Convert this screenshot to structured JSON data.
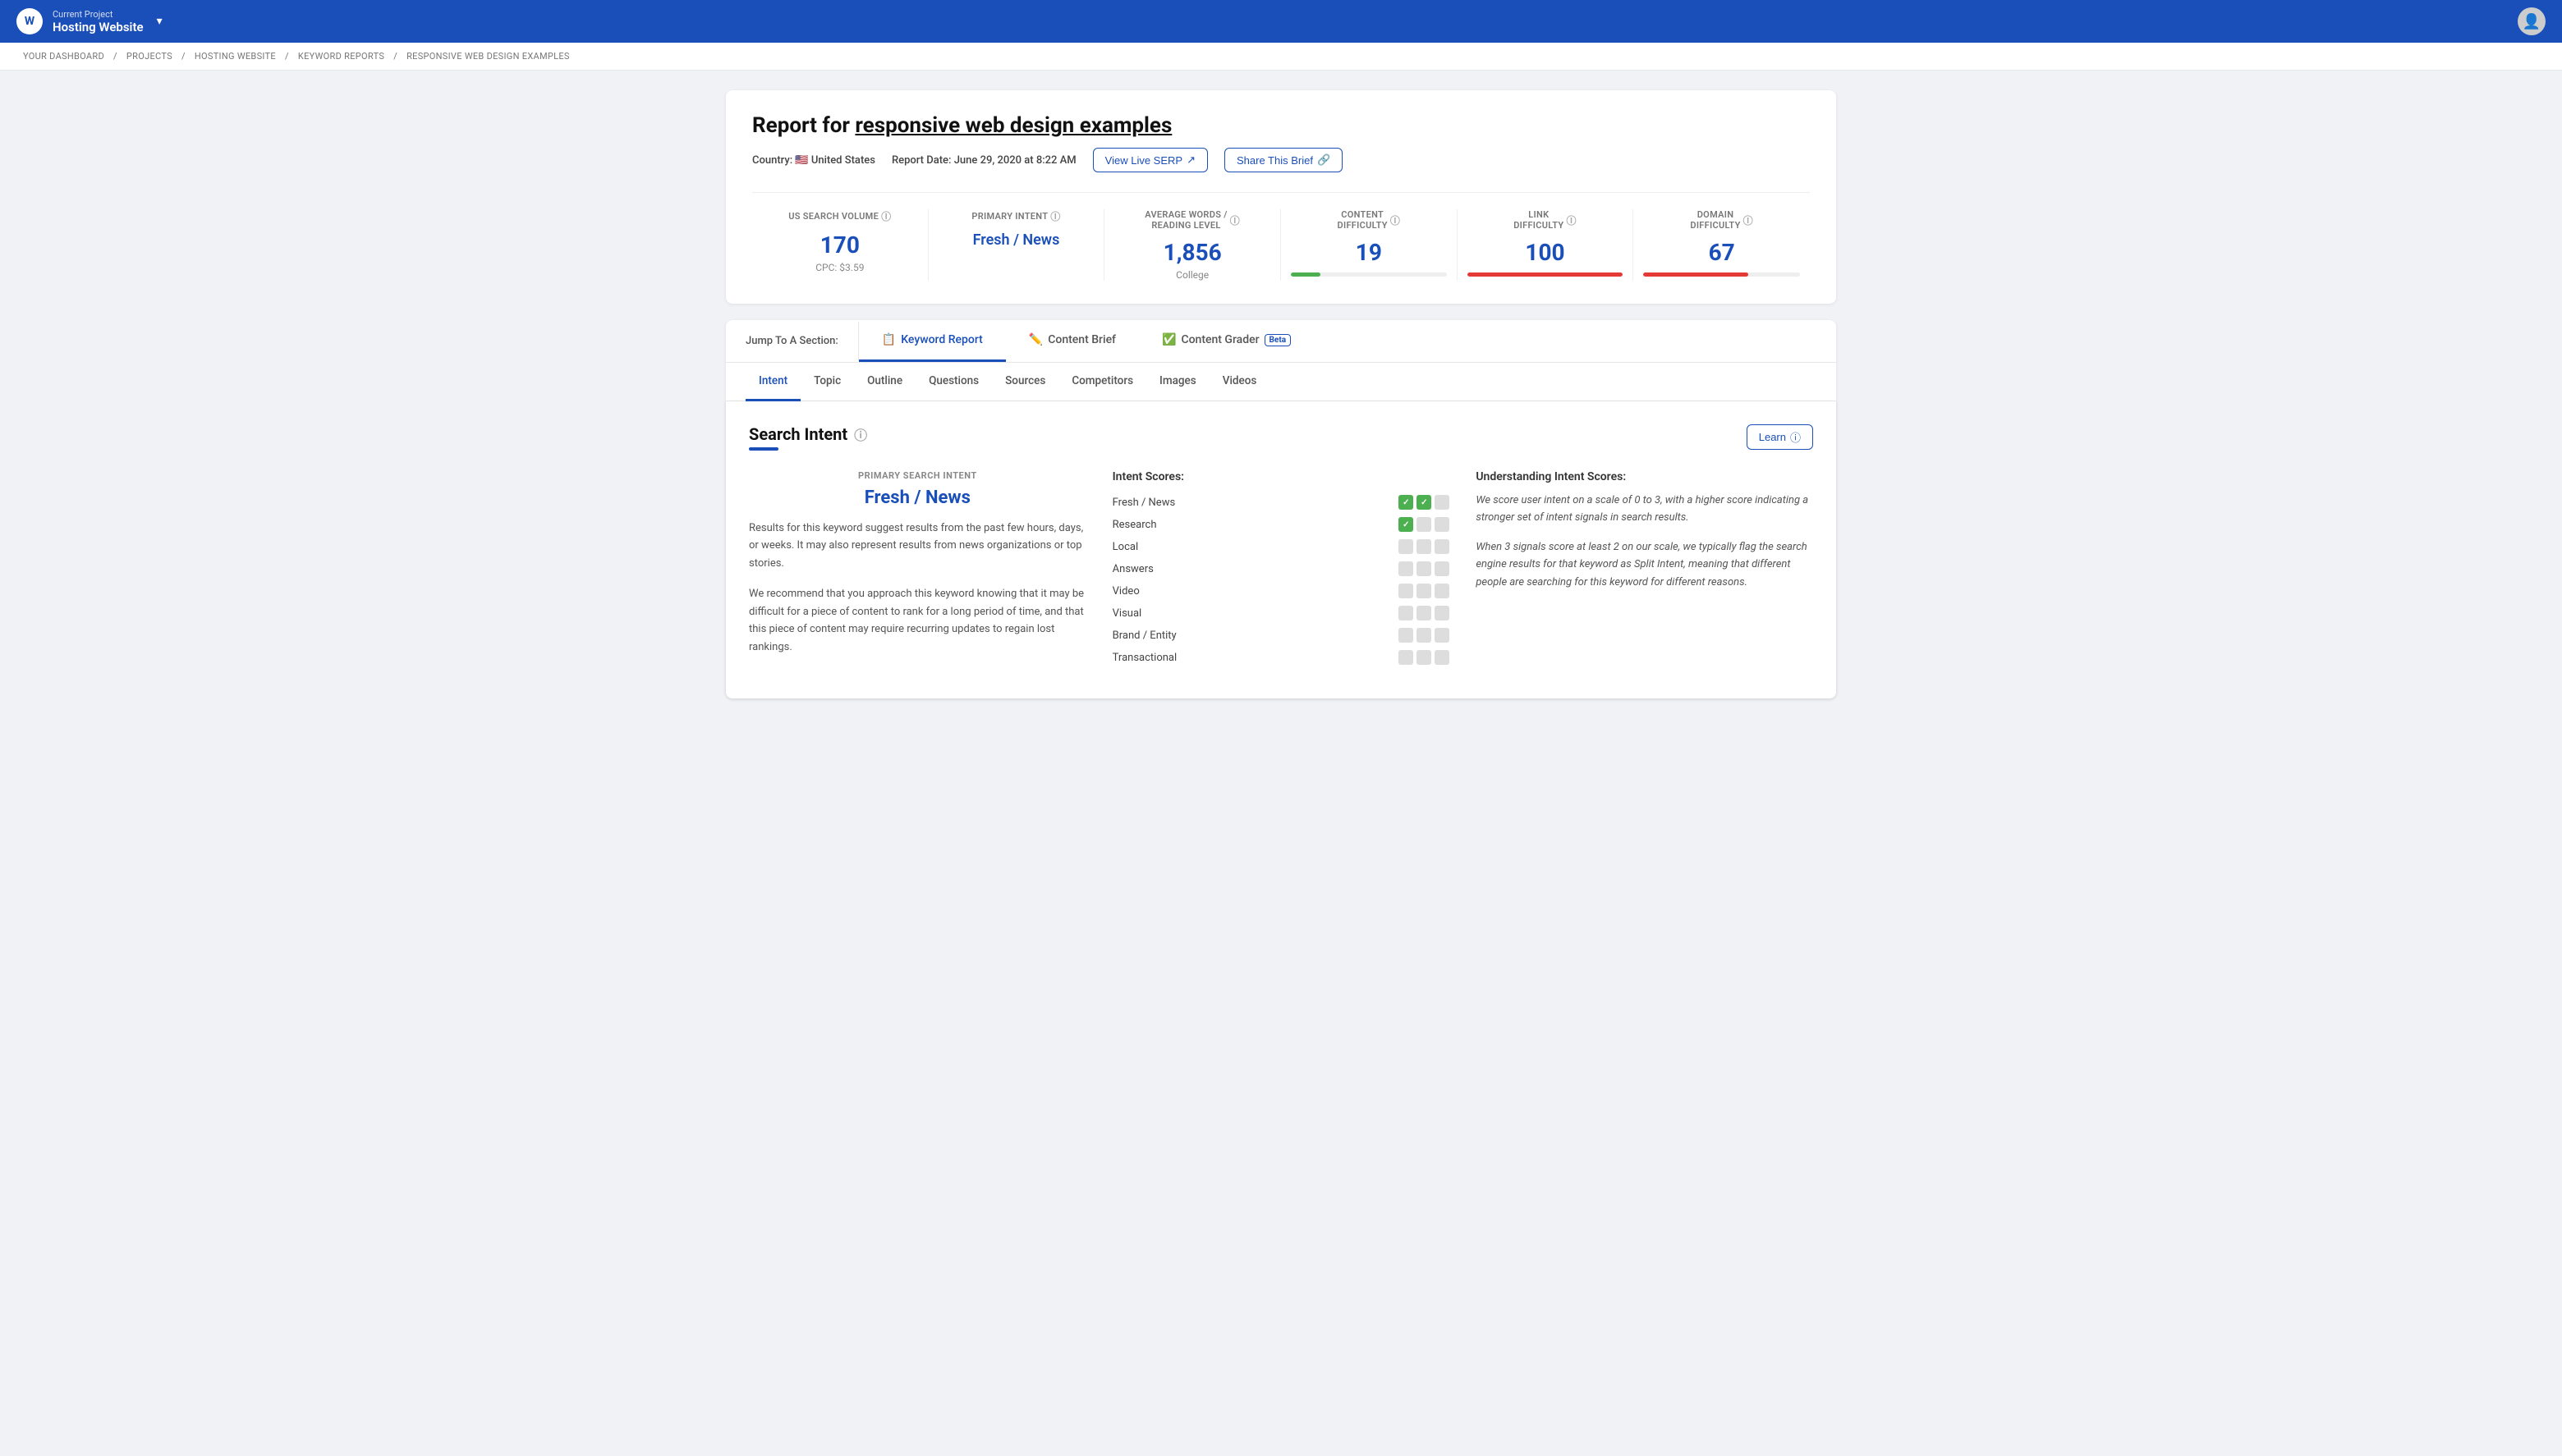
{
  "nav": {
    "project_label": "Current Project",
    "project_name": "Hosting Website",
    "avatar_icon": "👤"
  },
  "breadcrumb": {
    "items": [
      "YOUR DASHBOARD",
      "PROJECTS",
      "HOSTING WEBSITE",
      "KEYWORD REPORTS",
      "RESPONSIVE WEB DESIGN EXAMPLES"
    ],
    "separator": "/"
  },
  "report": {
    "title_prefix": "Report for",
    "keyword": "responsive web design examples",
    "country_flag": "🇺🇸",
    "country": "United States",
    "report_date_label": "Report Date:",
    "report_date": "June 29, 2020 at 8:22 AM",
    "view_live_serp": "View Live SERP",
    "share_brief": "Share This Brief",
    "metrics": [
      {
        "label": "US SEARCH VOLUME",
        "value": "170",
        "sub": "CPC: $3.59",
        "bar": null,
        "color": "#1a4fba"
      },
      {
        "label": "PRIMARY INTENT",
        "value": "Fresh / News",
        "sub": "",
        "bar": null,
        "color": "#1a4fba",
        "is_link": true
      },
      {
        "label": "AVERAGE WORDS / READING LEVEL",
        "value": "1,856",
        "sub": "College",
        "bar": null,
        "color": "#1a4fba"
      },
      {
        "label": "CONTENT DIFFICULTY",
        "value": "19",
        "sub": "",
        "bar": "green",
        "bar_pct": 19,
        "color": "#1a4fba"
      },
      {
        "label": "LINK DIFFICULTY",
        "value": "100",
        "sub": "",
        "bar": "red",
        "bar_pct": 100,
        "color": "#1a4fba"
      },
      {
        "label": "DOMAIN DIFFICULTY",
        "value": "67",
        "sub": "",
        "bar": "red",
        "bar_pct": 67,
        "color": "#1a4fba"
      }
    ]
  },
  "jump_tabs": [
    {
      "label": "📋 Keyword Report",
      "active": true
    },
    {
      "label": "✏️ Content Brief",
      "active": false
    },
    {
      "label": "✅ Content Grader",
      "active": false,
      "beta": true
    }
  ],
  "sub_tabs": [
    {
      "label": "Intent",
      "active": true
    },
    {
      "label": "Topic",
      "active": false
    },
    {
      "label": "Outline",
      "active": false
    },
    {
      "label": "Questions",
      "active": false
    },
    {
      "label": "Sources",
      "active": false
    },
    {
      "label": "Competitors",
      "active": false
    },
    {
      "label": "Images",
      "active": false
    },
    {
      "label": "Videos",
      "active": false
    }
  ],
  "intent_section": {
    "heading": "Search Intent",
    "learn_btn": "Learn",
    "primary_label": "PRIMARY SEARCH INTENT",
    "primary_value": "Fresh / News",
    "description_1": "Results for this keyword suggest results from the past few hours, days, or weeks. It may also represent results from news organizations or top stories.",
    "description_2": "We recommend that you approach this keyword knowing that it may be difficult for a piece of content to rank for a long period of time, and that this piece of content may require recurring updates to regain lost rankings.",
    "scores_title": "Intent Scores:",
    "scores": [
      {
        "label": "Fresh / News",
        "boxes": [
          2,
          0
        ]
      },
      {
        "label": "Research",
        "boxes": [
          1,
          0
        ]
      },
      {
        "label": "Local",
        "boxes": [
          0,
          0
        ]
      },
      {
        "label": "Answers",
        "boxes": [
          0,
          0
        ]
      },
      {
        "label": "Video",
        "boxes": [
          0,
          0
        ]
      },
      {
        "label": "Visual",
        "boxes": [
          0,
          0
        ]
      },
      {
        "label": "Brand / Entity",
        "boxes": [
          0,
          0
        ]
      },
      {
        "label": "Transactional",
        "boxes": [
          0,
          0
        ]
      }
    ],
    "understanding_title": "Understanding Intent Scores:",
    "understanding_1": "We score user intent on a scale of 0 to 3, with a higher score indicating a stronger set of intent signals in search results.",
    "understanding_2": "When 3 signals score at least 2 on our scale, we typically flag the search engine results for that keyword as Split Intent, meaning that different people are searching for this keyword for different reasons."
  }
}
